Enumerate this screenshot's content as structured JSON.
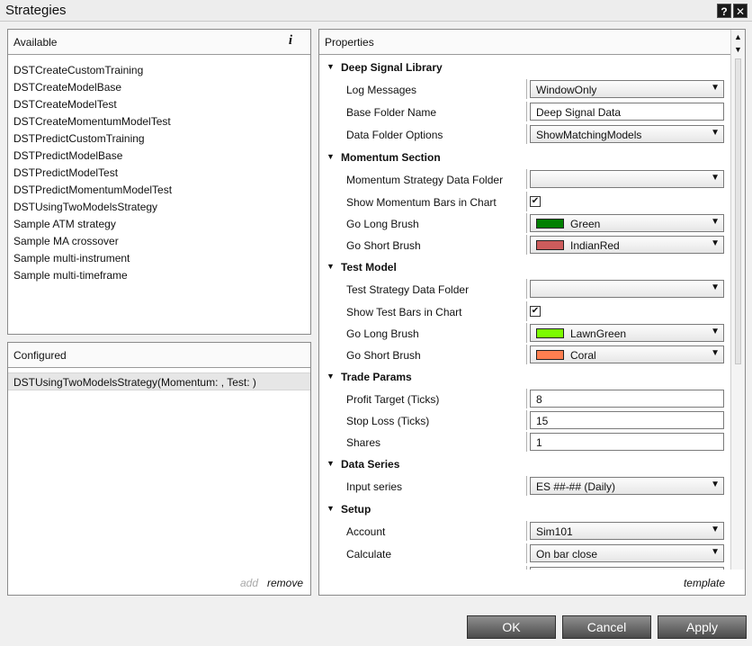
{
  "window": {
    "title": "Strategies",
    "help_glyph": "?",
    "close_glyph": "✕"
  },
  "available": {
    "header": "Available",
    "info_glyph": "i",
    "items": [
      "DSTCreateCustomTraining",
      "DSTCreateModelBase",
      "DSTCreateModelTest",
      "DSTCreateMomentumModelTest",
      "DSTPredictCustomTraining",
      "DSTPredictModelBase",
      "DSTPredictModelTest",
      "DSTPredictMomentumModelTest",
      "DSTUsingTwoModelsStrategy",
      "Sample ATM strategy",
      "Sample MA crossover",
      "Sample multi-instrument",
      "Sample multi-timeframe"
    ]
  },
  "configured": {
    "header": "Configured",
    "items": [
      "DSTUsingTwoModelsStrategy(Momentum: , Test: )"
    ],
    "add_label": "add",
    "remove_label": "remove"
  },
  "properties": {
    "header": "Properties",
    "template_label": "template",
    "sections": [
      {
        "label": "Deep Signal Library",
        "rows": [
          {
            "label": "Log Messages",
            "type": "combo",
            "value": "WindowOnly"
          },
          {
            "label": "Base Folder Name",
            "type": "text",
            "value": "Deep Signal Data"
          },
          {
            "label": "Data Folder Options",
            "type": "combo",
            "value": "ShowMatchingModels"
          }
        ]
      },
      {
        "label": "Momentum Section",
        "rows": [
          {
            "label": "Momentum Strategy Data Folder",
            "type": "combo",
            "value": ""
          },
          {
            "label": "Show Momentum Bars in Chart",
            "type": "check",
            "checked": true,
            "glyph": "✔"
          },
          {
            "label": "Go Long Brush",
            "type": "brush",
            "value": "Green",
            "color": "#008000"
          },
          {
            "label": "Go Short Brush",
            "type": "brush",
            "value": "IndianRed",
            "color": "#cd5c5c"
          }
        ]
      },
      {
        "label": "Test Model",
        "rows": [
          {
            "label": "Test Strategy Data Folder",
            "type": "combo",
            "value": ""
          },
          {
            "label": "Show Test Bars in Chart",
            "type": "check",
            "checked": true,
            "glyph": "✔"
          },
          {
            "label": "Go Long Brush",
            "type": "brush",
            "value": "LawnGreen",
            "color": "#7cfc00"
          },
          {
            "label": "Go Short Brush",
            "type": "brush",
            "value": "Coral",
            "color": "#ff7f50"
          }
        ]
      },
      {
        "label": "Trade Params",
        "rows": [
          {
            "label": "Profit Target (Ticks)",
            "type": "text",
            "value": "8"
          },
          {
            "label": "Stop Loss (Ticks)",
            "type": "text",
            "value": "15"
          },
          {
            "label": "Shares",
            "type": "text",
            "value": "1"
          }
        ]
      },
      {
        "label": "Data Series",
        "rows": [
          {
            "label": "Input series",
            "type": "combo",
            "value": "ES ##-## (Daily)"
          }
        ]
      },
      {
        "label": "Setup",
        "rows": [
          {
            "label": "Account",
            "type": "combo",
            "value": "Sim101"
          },
          {
            "label": "Calculate",
            "type": "combo",
            "value": "On bar close"
          },
          {
            "label": "",
            "type": "combo",
            "value": ""
          }
        ]
      }
    ]
  },
  "glyphs": {
    "expanded_arrow": "▼",
    "dropdown_caret": "▼",
    "scroll_up": "▲",
    "scroll_down": "▼"
  },
  "buttons": {
    "ok": "OK",
    "cancel": "Cancel",
    "apply": "Apply"
  }
}
